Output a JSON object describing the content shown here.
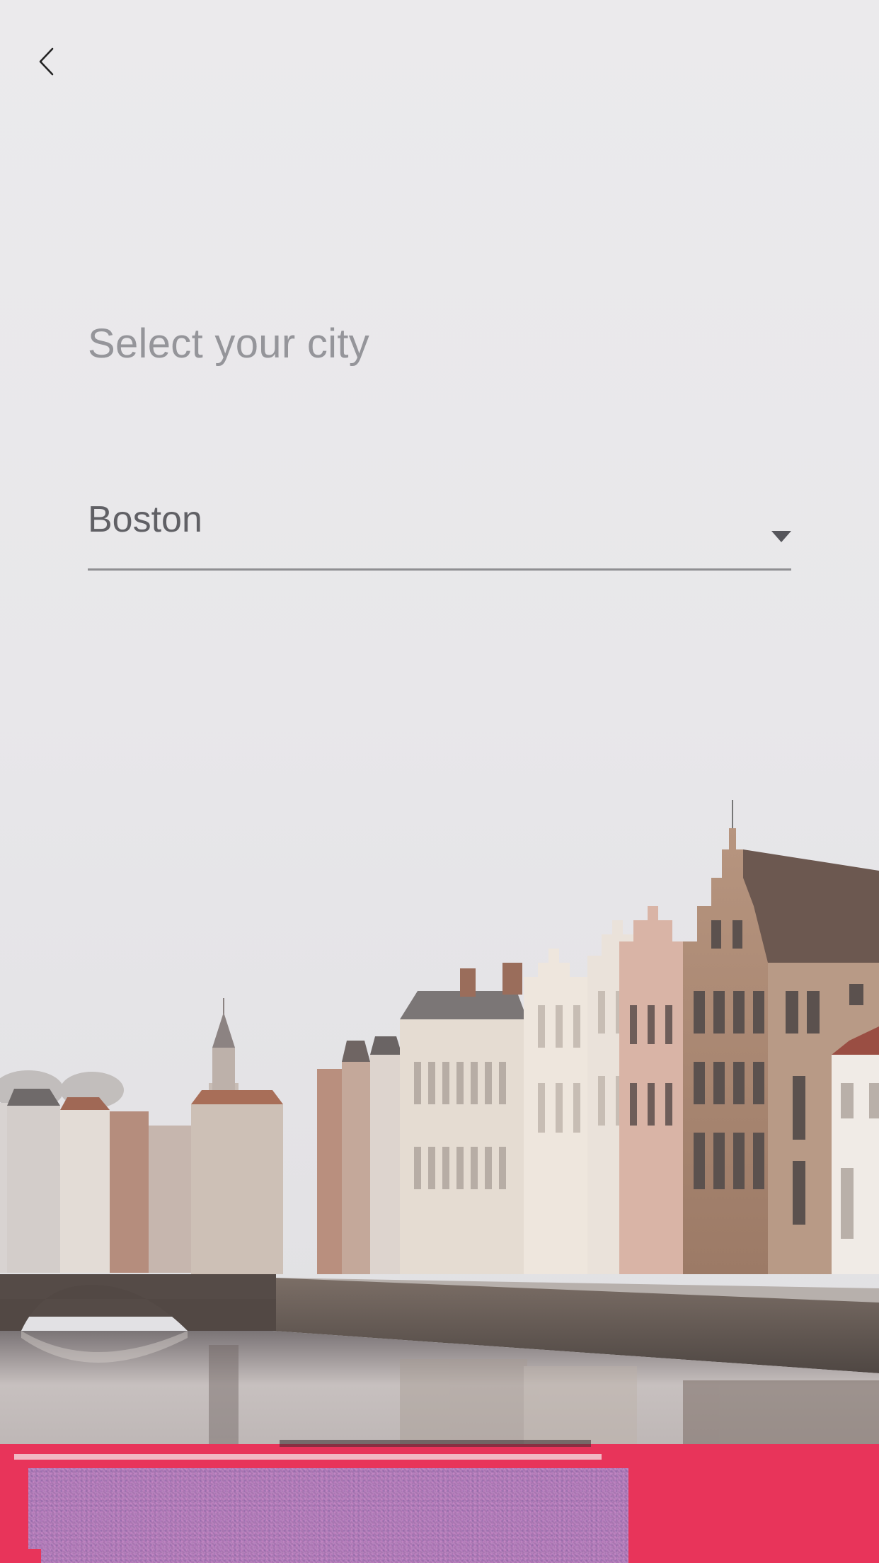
{
  "header": {
    "back_icon": "chevron-left-icon"
  },
  "main": {
    "title": "Select your city",
    "city_select": {
      "value": "Boston",
      "dropdown_icon": "triangle-down-icon"
    }
  },
  "background": {
    "image": "canal-city-photo"
  },
  "colors": {
    "bottom_bar": "#e8345a",
    "title_text": "#95959a",
    "value_text": "#606065",
    "underline": "#8f8f92"
  }
}
